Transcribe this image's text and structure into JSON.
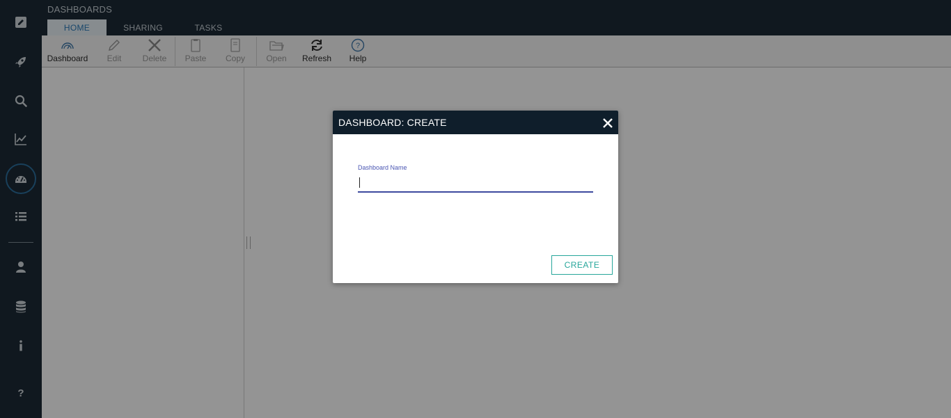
{
  "app": {
    "title": "DASHBOARDS"
  },
  "tabs": [
    {
      "label": "HOME",
      "active": true
    },
    {
      "label": "SHARING",
      "active": false
    },
    {
      "label": "TASKS",
      "active": false
    }
  ],
  "rail": {
    "items": [
      {
        "icon": "edit-icon"
      },
      {
        "icon": "rocket-icon"
      },
      {
        "icon": "search-icon"
      },
      {
        "icon": "chart-line-icon"
      },
      {
        "icon": "dashboard-gauge-icon",
        "active": true
      },
      {
        "icon": "list-icon"
      },
      {
        "icon": "user-icon"
      },
      {
        "icon": "database-icon"
      },
      {
        "icon": "info-icon"
      },
      {
        "icon": "help-icon"
      }
    ]
  },
  "toolbar": {
    "dashboard": "Dashboard",
    "edit": "Edit",
    "delete": "Delete",
    "paste": "Paste",
    "copy": "Copy",
    "open": "Open",
    "refresh": "Refresh",
    "help": "Help"
  },
  "dialog": {
    "title": "DASHBOARD: CREATE",
    "field_label": "Dashboard Name",
    "field_value": "",
    "create_label": "CREATE"
  },
  "colors": {
    "rail_bg": "#1c2a36",
    "dialog_header_bg": "#0f1e2b",
    "accent_teal": "#26a69a",
    "field_underline": "#3d4a9e",
    "active_tab_text": "#2b7bb9"
  }
}
